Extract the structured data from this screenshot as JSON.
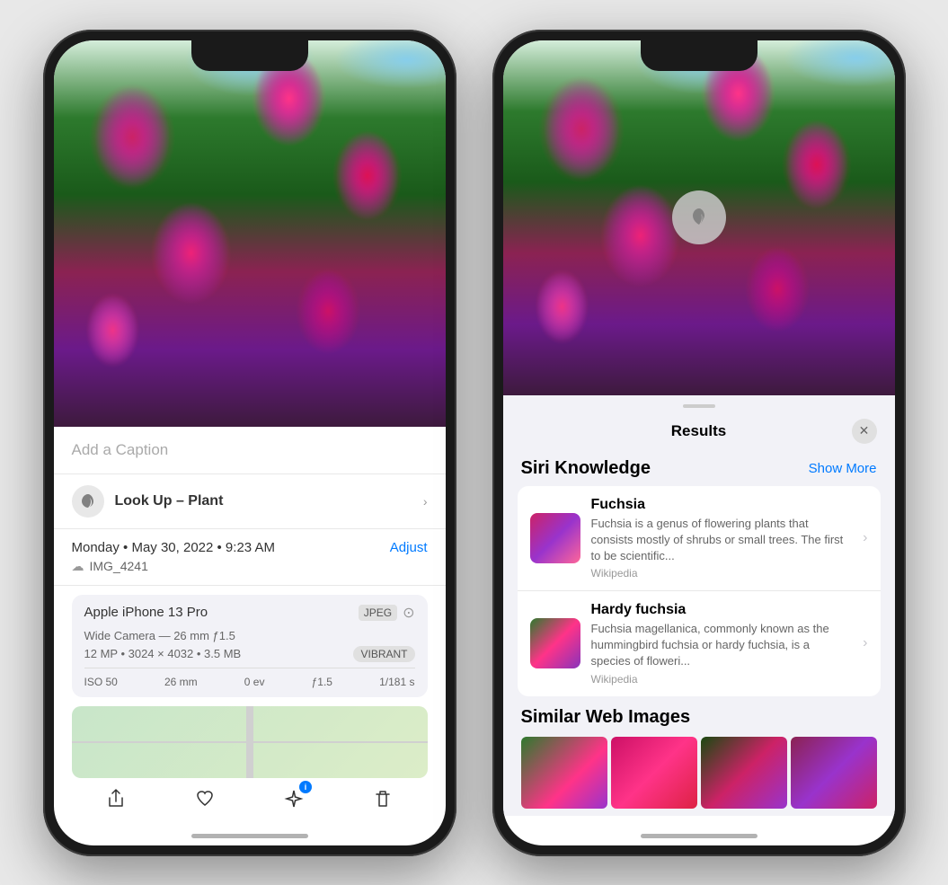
{
  "left_phone": {
    "caption_placeholder": "Add a Caption",
    "lookup": {
      "label": "Look Up – ",
      "value": "Plant",
      "chevron": "›"
    },
    "date": "Monday • May 30, 2022 • 9:23 AM",
    "adjust_label": "Adjust",
    "filename": "IMG_4241",
    "camera": {
      "name": "Apple iPhone 13 Pro",
      "badge": "JPEG",
      "detail": "Wide Camera — 26 mm ƒ1.5",
      "specs": "12 MP • 3024 × 4032 • 3.5 MB",
      "vibrant": "VIBRANT",
      "exif": {
        "iso": "ISO 50",
        "focal": "26 mm",
        "ev": "0 ev",
        "aperture": "ƒ1.5",
        "shutter": "1/181 s"
      }
    },
    "toolbar": {
      "share": "⬆",
      "heart": "♡",
      "info": "✦ⓘ",
      "trash": "🗑"
    }
  },
  "right_phone": {
    "sheet": {
      "title": "Results",
      "close": "✕"
    },
    "siri_knowledge": {
      "section_title": "Siri Knowledge",
      "show_more": "Show More",
      "items": [
        {
          "title": "Fuchsia",
          "description": "Fuchsia is a genus of flowering plants that consists mostly of shrubs or small trees. The first to be scientific...",
          "source": "Wikipedia"
        },
        {
          "title": "Hardy fuchsia",
          "description": "Fuchsia magellanica, commonly known as the hummingbird fuchsia or hardy fuchsia, is a species of floweri...",
          "source": "Wikipedia"
        }
      ]
    },
    "similar_section": {
      "title": "Similar Web Images"
    }
  }
}
